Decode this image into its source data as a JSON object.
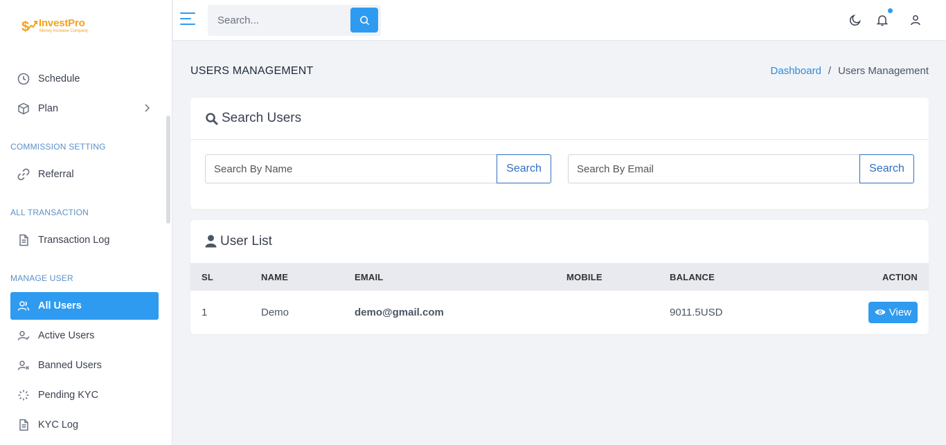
{
  "brand": {
    "name": "InvestPro",
    "tagline": "Money Increase Company",
    "color": "#f4a21a"
  },
  "sidebar": {
    "items": [
      {
        "label": "Schedule",
        "icon": "clock-icon"
      },
      {
        "label": "Plan",
        "icon": "box-icon",
        "has_submenu": true
      }
    ],
    "sections": [
      {
        "title": "COMMISSION SETTING",
        "items": [
          {
            "label": "Referral",
            "icon": "link-icon"
          }
        ]
      },
      {
        "title": "ALL TRANSACTION",
        "items": [
          {
            "label": "Transaction Log",
            "icon": "document-icon"
          }
        ]
      },
      {
        "title": "MANAGE USER",
        "items": [
          {
            "label": "All Users",
            "icon": "users-icon",
            "active": true
          },
          {
            "label": "Active Users",
            "icon": "user-check-icon"
          },
          {
            "label": "Banned Users",
            "icon": "user-x-icon"
          },
          {
            "label": "Pending KYC",
            "icon": "loader-icon"
          },
          {
            "label": "KYC Log",
            "icon": "document-icon"
          }
        ]
      }
    ]
  },
  "topbar": {
    "search_placeholder": "Search..."
  },
  "page": {
    "title": "USERS MANAGEMENT",
    "breadcrumb": {
      "home": "Dashboard",
      "separator": "/",
      "current": "Users Management"
    }
  },
  "search_card": {
    "title": "Search Users",
    "name_placeholder": "Search By Name",
    "email_placeholder": "Search By Email",
    "button_label": "Search"
  },
  "user_list": {
    "title": "User List",
    "columns": [
      "SL",
      "NAME",
      "EMAIL",
      "MOBILE",
      "BALANCE",
      "ACTION"
    ],
    "rows": [
      {
        "sl": "1",
        "name": "Demo",
        "email": "demo@gmail.com",
        "mobile": "",
        "balance": "9011.5USD",
        "action": "View"
      }
    ]
  },
  "colors": {
    "accent": "#2e9bf0",
    "outline_button": "#2d6fbf"
  }
}
